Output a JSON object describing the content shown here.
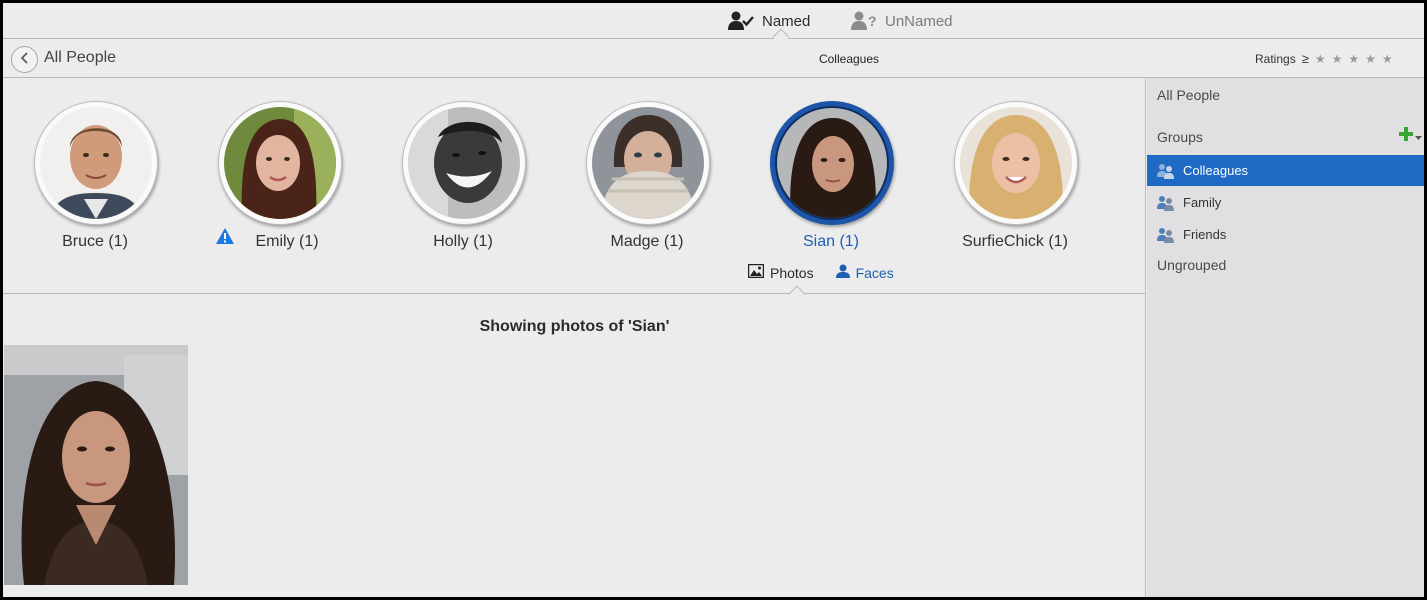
{
  "top_tabs": {
    "named": "Named",
    "unnamed": "UnNamed"
  },
  "header": {
    "back_label": "All People",
    "group_title": "Colleagues",
    "ratings_label": "Ratings",
    "ratings_op": "≥",
    "stars": 5
  },
  "people": [
    {
      "name": "Bruce (1)"
    },
    {
      "name": "Emily (1)"
    },
    {
      "name": "Holly (1)"
    },
    {
      "name": "Madge (1)"
    },
    {
      "name": "Sian (1)"
    },
    {
      "name": "SurfieChick (1)"
    }
  ],
  "subtabs": {
    "photos": "Photos",
    "faces": "Faces"
  },
  "showing_text": "Showing photos of 'Sian'",
  "sidebar": {
    "all_people": "All People",
    "groups_label": "Groups",
    "groups": [
      "Colleagues",
      "Family",
      "Friends"
    ],
    "ungrouped": "Ungrouped"
  },
  "colors": {
    "accent": "#1e6ac4",
    "selected_ring": "#1d56a8",
    "add_icon": "#3aa535",
    "warning": "#1e78e0"
  }
}
